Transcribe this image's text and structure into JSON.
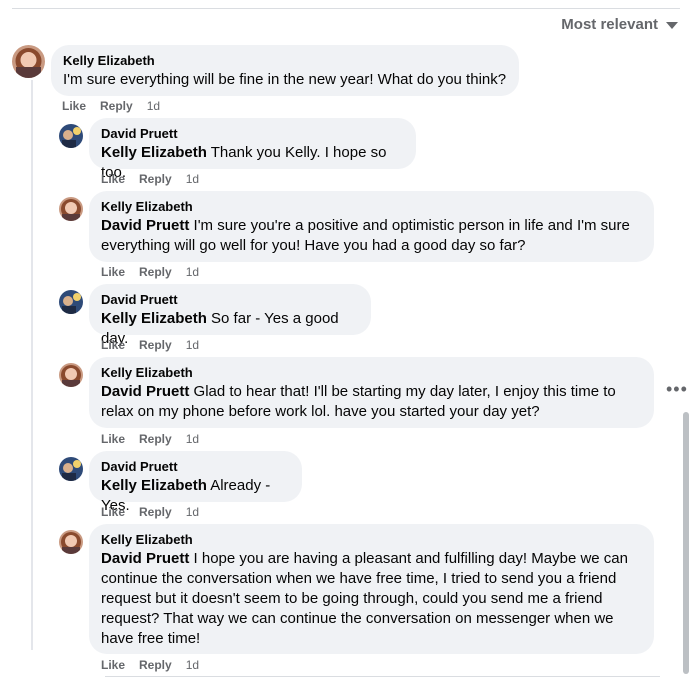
{
  "sort": {
    "label": "Most relevant"
  },
  "comments": [
    {
      "author": "Kelly Elizabeth",
      "mention": "",
      "text": "I'm sure everything will be fine in the new year! What do you think?",
      "like": "Like",
      "reply": "Reply",
      "time": "1d"
    },
    {
      "author": "David Pruett",
      "mention": "Kelly Elizabeth",
      "text": " Thank you Kelly. I hope so too.",
      "like": "Like",
      "reply": "Reply",
      "time": "1d"
    },
    {
      "author": "Kelly Elizabeth",
      "mention": "David Pruett",
      "text": " I'm sure you're a positive and optimistic person in life and I'm sure everything will go well for you! Have you had a good day so far?",
      "like": "Like",
      "reply": "Reply",
      "time": "1d"
    },
    {
      "author": "David Pruett",
      "mention": "Kelly Elizabeth",
      "text": " So far - Yes a good day.",
      "like": "Like",
      "reply": "Reply",
      "time": "1d"
    },
    {
      "author": "Kelly Elizabeth",
      "mention": "David Pruett",
      "text": " Glad to hear that! I'll be starting my day later, I enjoy this time to relax on my phone before work lol. have you started your day yet?",
      "like": "Like",
      "reply": "Reply",
      "time": "1d"
    },
    {
      "author": "David Pruett",
      "mention": "Kelly Elizabeth",
      "text": " Already - Yes.",
      "like": "Like",
      "reply": "Reply",
      "time": "1d"
    },
    {
      "author": "Kelly Elizabeth",
      "mention": "David Pruett",
      "text": " I hope you are having a pleasant and fulfilling day! Maybe we can continue the conversation when we have free time, I tried to send you a friend request but it doesn't seem to be going through, could you send me a friend request? That way we can continue the conversation on messenger when we have free time!",
      "like": "Like",
      "reply": "Reply",
      "time": "1d"
    }
  ],
  "icons": {
    "sort": "caret-down-icon",
    "more": "more-options-icon"
  },
  "colors": {
    "bubble": "#f0f2f5",
    "secondary_text": "#65676b"
  }
}
